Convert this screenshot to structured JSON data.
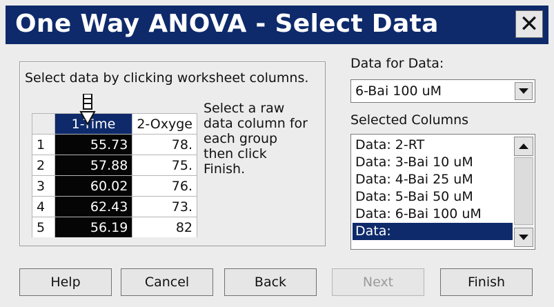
{
  "window": {
    "title": "One Way ANOVA - Select Data",
    "close_glyph": "✕"
  },
  "left_panel": {
    "instruction": "Select data by clicking worksheet columns.",
    "hint_lines": [
      "Select a raw",
      "data column for",
      "each group",
      "then click",
      "Finish."
    ],
    "worksheet": {
      "columns": [
        "1-Time",
        "2-Oxyge"
      ],
      "rows": [
        {
          "row": "1",
          "c1": "55.73",
          "c2": "78."
        },
        {
          "row": "2",
          "c1": "57.88",
          "c2": "75."
        },
        {
          "row": "3",
          "c1": "60.02",
          "c2": "76."
        },
        {
          "row": "4",
          "c1": "62.43",
          "c2": "73."
        },
        {
          "row": "5",
          "c1": "56.19",
          "c2": "82"
        }
      ]
    }
  },
  "right_panel": {
    "data_for_label": "Data for Data:",
    "data_for_value": "6-Bai 100 uM",
    "selected_label": "Selected Columns",
    "selected_items": [
      {
        "text": "Data: 2-RT",
        "selected": false
      },
      {
        "text": "Data: 3-Bai 10 uM",
        "selected": false
      },
      {
        "text": "Data: 4-Bai 25 uM",
        "selected": false
      },
      {
        "text": "Data: 5-Bai 50 uM",
        "selected": false
      },
      {
        "text": "Data: 6-Bai 100 uM",
        "selected": false
      },
      {
        "text": "Data:",
        "selected": true
      }
    ]
  },
  "buttons": {
    "help": "Help",
    "cancel": "Cancel",
    "back": "Back",
    "next": "Next",
    "finish": "Finish"
  },
  "colors": {
    "title_bar": "#0e2a6b",
    "selection": "#0e2a6b",
    "selected_column": "#050505",
    "dialog_bg": "#ececec"
  }
}
